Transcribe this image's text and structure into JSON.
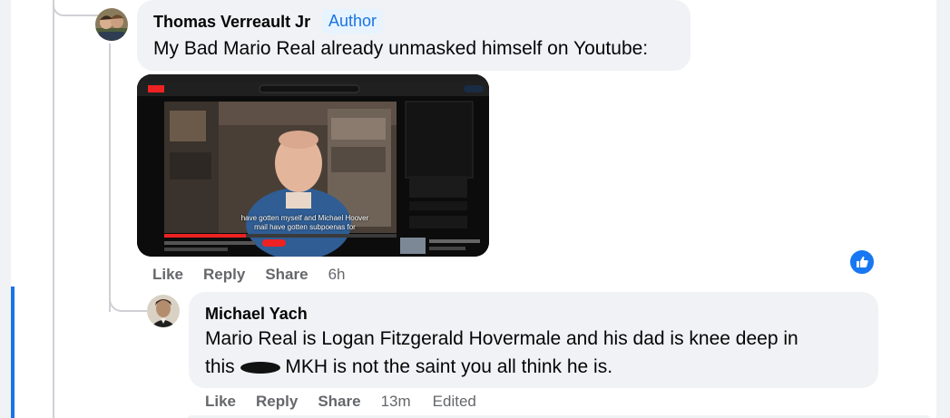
{
  "comment": {
    "author": "Thomas Verreault Jr",
    "badge": "Author",
    "text": "My Bad Mario Real already unmasked himself on Youtube:",
    "actions": {
      "like": "Like",
      "reply": "Reply",
      "share": "Share",
      "time": "6h"
    },
    "video": {
      "subtitle_line1": "have gotten myself and Michael Hoover",
      "subtitle_line2": "mail have gotten subpoenas for"
    }
  },
  "reply": {
    "author": "Michael Yach",
    "text_line1": "Mario Real is Logan Fitzgerald Hovermale and his dad is knee deep in",
    "text_before": "this",
    "text_after": " MKH is not the saint you all think he is.",
    "actions": {
      "like": "Like",
      "reply": "Reply",
      "share": "Share",
      "time": "13m",
      "edited": "Edited"
    }
  },
  "colors": {
    "accent": "#1b74e4",
    "bubble": "#f0f2f5",
    "secondary_text": "#65676b",
    "badge_bg": "#e7f3ff"
  },
  "icons": {
    "reaction": "thumbs-up-icon",
    "redaction": "redacted-word-mark"
  }
}
